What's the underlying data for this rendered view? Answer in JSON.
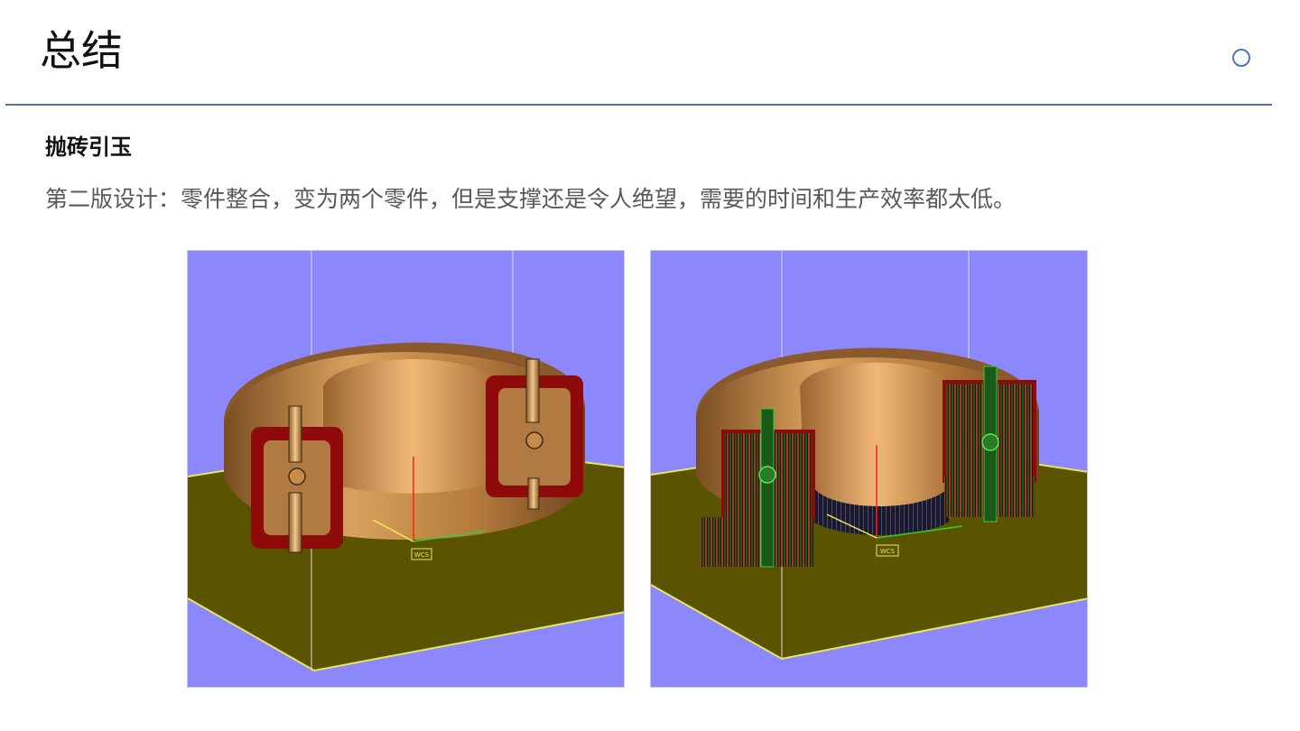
{
  "slide": {
    "title": "总结",
    "subheading": "抛砖引玉",
    "body": "第二版设计：零件整合，变为两个零件，但是支撑还是令人绝望，需要的时间和生产效率都太低。"
  },
  "figures": [
    {
      "name": "ring-part-without-supports",
      "axis_tag": "WCS"
    },
    {
      "name": "ring-part-with-supports",
      "axis_tag": "WCS"
    }
  ],
  "colors": {
    "background_blue": "#8c87fb",
    "build_plate": "#5a5400",
    "part_copper": "#c98b4e",
    "cut_face_red": "#8f0b0b",
    "support_green": "#1f9a1f",
    "rule": "#4f76a3",
    "accent_circle": "#4a7bb0"
  }
}
